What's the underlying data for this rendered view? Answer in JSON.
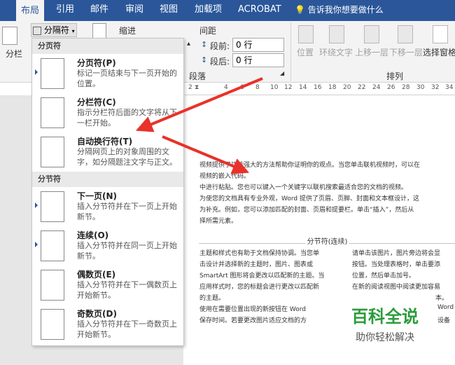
{
  "tabs": [
    "布局",
    "引用",
    "邮件",
    "审阅",
    "视图",
    "加载项",
    "ACROBAT"
  ],
  "tell_me": "告诉我你想要做什么",
  "ribbon": {
    "breaks_button": "分隔符",
    "columns_label": "分栏",
    "indent_label": "缩进",
    "spacing_label": "间距",
    "before_label": "段前:",
    "before_value": "0 行",
    "after_label": "段后:",
    "after_value": "0 行",
    "paragraph_group": "段落",
    "arrange_group": "排列",
    "arrange_items": [
      "位置",
      "环绕文字",
      "上移一层",
      "下移一层",
      "选择窗格"
    ]
  },
  "ruler_ticks": [
    "2",
    "4",
    "6",
    "8",
    "10",
    "12",
    "14",
    "16",
    "18",
    "20",
    "22",
    "24",
    "26",
    "28",
    "30",
    "32",
    "34"
  ],
  "dropdown": {
    "page_breaks_header": "分页符",
    "section_breaks_header": "分节符",
    "items": [
      {
        "title": "分页符(P)",
        "desc": "标记一页结束与下一页开始的位置。"
      },
      {
        "title": "分栏符(C)",
        "desc": "指示分栏符后面的文字将从下一栏开始。"
      },
      {
        "title": "自动换行符(T)",
        "desc": "分隔网页上的对象周围的文字，如分隔题注文字与正文。"
      },
      {
        "title": "下一页(N)",
        "desc": "插入分节符并在下一页上开始新节。"
      },
      {
        "title": "连续(O)",
        "desc": "插入分节符并在同一页上开始新节。"
      },
      {
        "title": "偶数页(E)",
        "desc": "插入分节符并在下一偶数页上开始新节。"
      },
      {
        "title": "奇数页(D)",
        "desc": "插入分节符并在下一奇数页上开始新节。"
      }
    ]
  },
  "document": {
    "lines": [
      "视频提供了功能强大的方法帮助你证明你的观点。当您单击联机视频时，可以在",
      "视频的嵌入代码。",
      "中进行粘贴。您也可以键入一个关键字以联机搜索最适合您的文档的视频。",
      "为使您的文档具有专业外观，Word 提供了页眉、页脚、封面和文本框设计，这",
      "为补充。例如，您可以添加匹配的封面、页眉和提要栏。单击“插入”，然后从",
      "择所需元素。"
    ],
    "section_break_label": "分节符(连续)",
    "col1": [
      "主题和样式也有助于文档保持协调。当您单",
      "击设计并选择新的主题时，图片、图表或",
      "SmartArt 图形将会更改以匹配新的主题。当",
      "应用样式时，您的标题会进行更改以匹配新",
      "的主题。",
      "使用在需要位置出现的新按钮在 Word",
      "保存时间。若要更改图片适应文档的方"
    ],
    "col2": [
      "请单击该图片，图片旁边将会显",
      "按钮。当处理表格时，单击要添",
      "位置，然后单击加号。",
      "在新的阅读视图中阅读更加容易",
      "本。",
      "Word",
      "设备"
    ]
  },
  "watermark": {
    "title": "百科全说",
    "subtitle": "助你轻松解决"
  },
  "colors": {
    "accent": "#2b579a",
    "arrow": "#e8322a",
    "watermark_green": "#2a9c3a"
  }
}
